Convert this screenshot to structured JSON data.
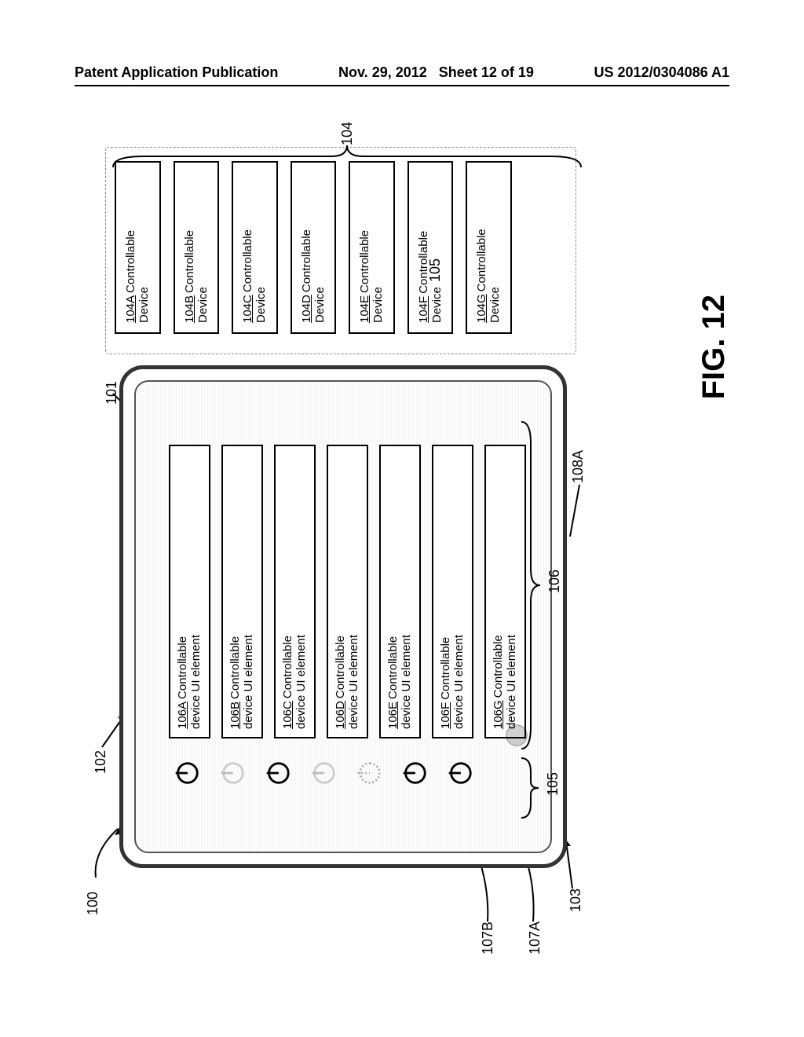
{
  "header": {
    "left": "Patent Application Publication",
    "date": "Nov. 29, 2012",
    "sheet": "Sheet 12 of 19",
    "pubnum": "US 2012/0304086 A1"
  },
  "figure": {
    "label": "FIG. 12",
    "ref100": "100",
    "ref101": "101",
    "ref102": "102",
    "ref103": "103",
    "ref104": "104",
    "ref105": "105",
    "ref106": "106",
    "ref107a": "107A",
    "ref107b": "107B",
    "ref108a": "108A",
    "ui_elements": [
      {
        "id": "106A",
        "text": "Controllable device UI element"
      },
      {
        "id": "106B",
        "text": "Controllable device UI element"
      },
      {
        "id": "106C",
        "text": "Controllable device UI element"
      },
      {
        "id": "106D",
        "text": "Controllable device UI element"
      },
      {
        "id": "106E",
        "text": "Controllable device UI element"
      },
      {
        "id": "106F",
        "text": "Controllable device UI element"
      },
      {
        "id": "106G",
        "text": "Controllable device UI element"
      }
    ],
    "devices": [
      {
        "id": "104A",
        "text": "Controllable Device"
      },
      {
        "id": "104B",
        "text": "Controllable Device"
      },
      {
        "id": "104C",
        "text": "Controllable Device"
      },
      {
        "id": "104D",
        "text": "Controllable Device"
      },
      {
        "id": "104E",
        "text": "Controllable Device"
      },
      {
        "id": "104F",
        "text": "Controllable Device"
      },
      {
        "id": "104G",
        "text": "Controllable Device"
      }
    ],
    "icon_states": [
      "on",
      "off",
      "on",
      "off",
      "dotted",
      "on",
      "on"
    ]
  }
}
